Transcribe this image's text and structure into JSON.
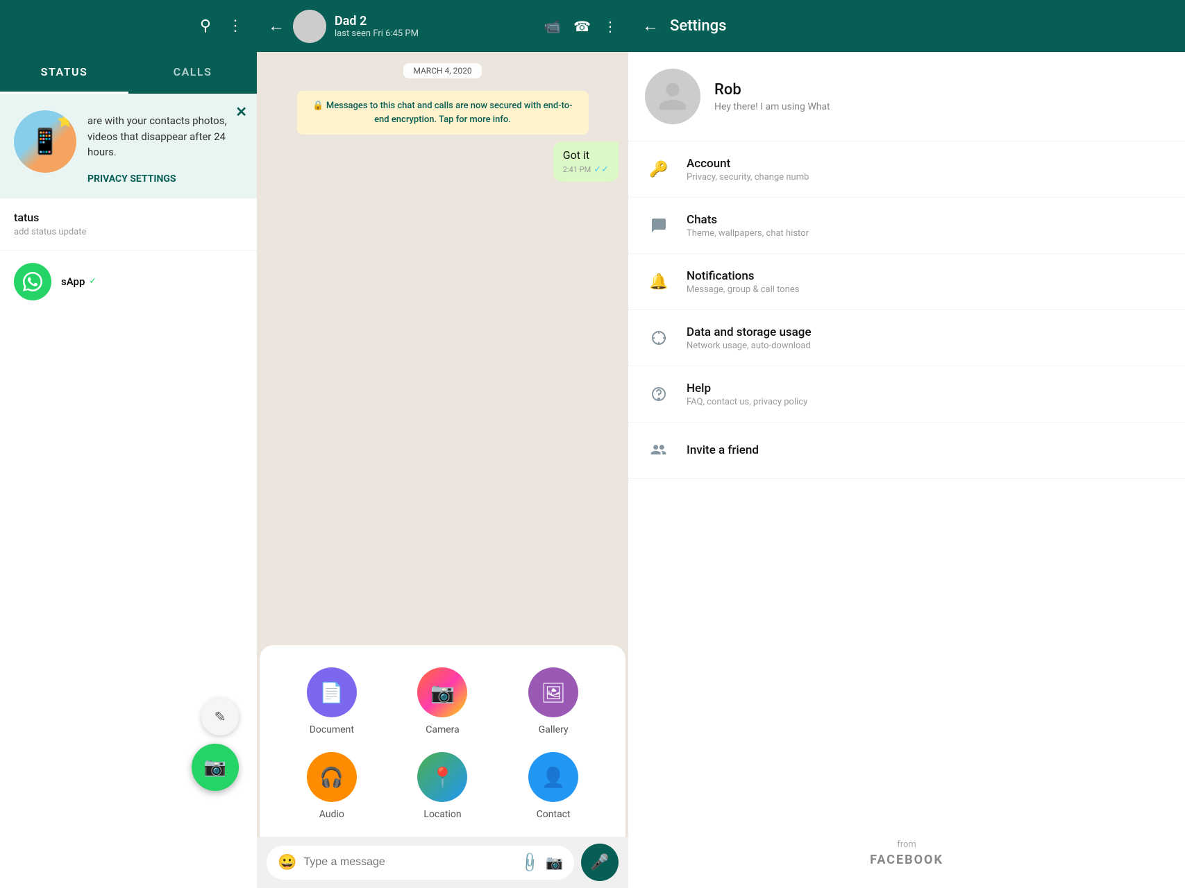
{
  "left_panel": {
    "tabs": [
      {
        "id": "status",
        "label": "STATUS",
        "active": true
      },
      {
        "id": "calls",
        "label": "CALLS",
        "active": false
      }
    ],
    "promo": {
      "text": "are with your contacts photos, videos that disappear after 24 hours.",
      "link": "PRIVACY SETTINGS"
    },
    "my_status": {
      "title": "tatus",
      "subtitle": "add status update"
    },
    "whatsapp": {
      "name": "sApp",
      "verified": "✓"
    }
  },
  "chat": {
    "contact_name": "Dad 2",
    "last_seen": "last seen Fri 6:45 PM",
    "date_badge": "MARCH 4, 2020",
    "system_msg": "🔒 Messages to this chat and calls are now secured with end-to-end encryption. Tap for more info.",
    "message": {
      "text": "Got it",
      "time": "2:41 PM",
      "ticks": "✓✓"
    },
    "input_placeholder": "Type a message",
    "attach_items": [
      {
        "id": "document",
        "label": "Document",
        "icon": "📄",
        "css_class": "icon-document"
      },
      {
        "id": "camera",
        "label": "Camera",
        "icon": "📷",
        "css_class": "icon-camera"
      },
      {
        "id": "gallery",
        "label": "Gallery",
        "icon": "🖼",
        "css_class": "icon-gallery"
      },
      {
        "id": "audio",
        "label": "Audio",
        "icon": "🎧",
        "css_class": "icon-audio"
      },
      {
        "id": "location",
        "label": "Location",
        "icon": "📍",
        "css_class": "icon-location"
      },
      {
        "id": "contact",
        "label": "Contact",
        "icon": "👤",
        "css_class": "icon-contact"
      }
    ]
  },
  "settings": {
    "title": "Settings",
    "profile": {
      "name": "Rob",
      "status": "Hey there! I am using What"
    },
    "items": [
      {
        "id": "account",
        "title": "Account",
        "subtitle": "Privacy, security, change numb",
        "icon": "🔑"
      },
      {
        "id": "chats",
        "title": "Chats",
        "subtitle": "Theme, wallpapers, chat histor",
        "icon": "💬"
      },
      {
        "id": "notifications",
        "title": "Notifications",
        "subtitle": "Message, group & call tones",
        "icon": "🔔"
      },
      {
        "id": "data",
        "title": "Data and storage usage",
        "subtitle": "Network usage, auto-download",
        "icon": "🔄"
      },
      {
        "id": "help",
        "title": "Help",
        "subtitle": "FAQ, contact us, privacy policy",
        "icon": "❓"
      },
      {
        "id": "invite",
        "title": "Invite a friend",
        "subtitle": "",
        "icon": "👥"
      }
    ],
    "footer": {
      "from_label": "from",
      "brand": "FACEBOOK"
    }
  }
}
